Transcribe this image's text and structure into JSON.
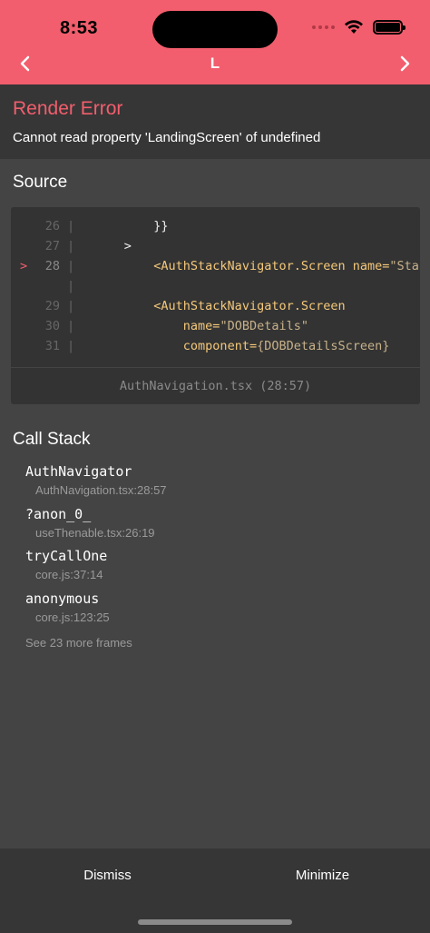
{
  "status": {
    "time": "8:53"
  },
  "nav": {
    "title": "L"
  },
  "error": {
    "title": "Render Error",
    "message": "Cannot read property 'LandingScreen' of undefined"
  },
  "source": {
    "title": "Source",
    "lines": [
      {
        "number": "26",
        "marker": "",
        "bar": "|",
        "indent": "          ",
        "text": "}}"
      },
      {
        "number": "27",
        "marker": "",
        "bar": "|",
        "indent": "      ",
        "text": ">"
      },
      {
        "number": "28",
        "marker": ">",
        "bar": "|",
        "indent": "          ",
        "tag": "<AuthStackNavigator.Screen",
        "attr": " name=",
        "str": "\"Sta"
      },
      {
        "number": "",
        "marker": "",
        "bar": "|",
        "indent": "",
        "text": ""
      },
      {
        "number": "29",
        "marker": "",
        "bar": "|",
        "indent": "          ",
        "tag": "<AuthStackNavigator.Screen"
      },
      {
        "number": "30",
        "marker": "",
        "bar": "|",
        "indent": "              ",
        "attr": "name=",
        "str": "\"DOBDetails\""
      },
      {
        "number": "31",
        "marker": "",
        "bar": "|",
        "indent": "              ",
        "attr": "component=",
        "str": "{DOBDetailsScreen}"
      }
    ],
    "file": "AuthNavigation.tsx (28:57)"
  },
  "callstack": {
    "title": "Call Stack",
    "frames": [
      {
        "name": "AuthNavigator",
        "location": "AuthNavigation.tsx:28:57"
      },
      {
        "name": "?anon_0_",
        "location": "useThenable.tsx:26:19"
      },
      {
        "name": "tryCallOne",
        "location": "core.js:37:14"
      },
      {
        "name": "anonymous",
        "location": "core.js:123:25"
      }
    ],
    "more": "See 23 more frames"
  },
  "footer": {
    "dismiss": "Dismiss",
    "minimize": "Minimize"
  },
  "colors": {
    "header": "#f25e6d",
    "error_title": "#f25e6d",
    "background": "#444444",
    "panel": "#363636",
    "code_bg": "#333333"
  },
  "icons": {
    "back": "chevron-left-icon",
    "forward": "chevron-right-icon",
    "wifi": "wifi-icon",
    "battery": "battery-icon"
  }
}
